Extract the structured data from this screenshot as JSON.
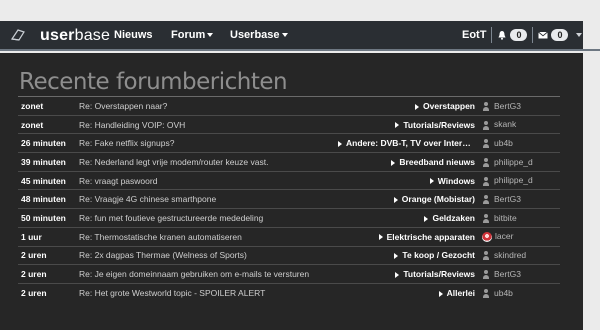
{
  "navbar": {
    "brand_prefix": "user",
    "brand_suffix": "base",
    "menu": [
      {
        "label": "Nieuws",
        "dropdown": false
      },
      {
        "label": "Forum",
        "dropdown": true
      },
      {
        "label": "Userbase",
        "dropdown": true
      }
    ],
    "username": "EotT",
    "notifications_count": "0",
    "messages_count": "0",
    "icons": [
      "logo-icon",
      "bell-icon",
      "envelope-icon",
      "chevron-down-icon"
    ]
  },
  "page": {
    "title": "Recente forumberichten"
  },
  "topics": [
    {
      "time": "zonet",
      "title": "Re: Overstappen naar?",
      "forum": "Overstappen",
      "user": "BertG3",
      "avatar": "user-icon"
    },
    {
      "time": "zonet",
      "title": "Re: Handleiding VOIP: OVH",
      "forum": "Tutorials/Reviews",
      "user": "skank",
      "avatar": "user-icon"
    },
    {
      "time": "26 minuten",
      "title": "Re: Fake netflix signups?",
      "forum": "Andere: DVB-T, TV over Interne...",
      "user": "ub4b",
      "avatar": "user-icon"
    },
    {
      "time": "39 minuten",
      "title": "Re: Nederland legt vrije modem/router keuze vast.",
      "forum": "Breedband nieuws",
      "user": "philippe_d",
      "avatar": "user-icon"
    },
    {
      "time": "45 minuten",
      "title": "Re: vraagt paswoord",
      "forum": "Windows",
      "user": "philippe_d",
      "avatar": "user-icon"
    },
    {
      "time": "48 minuten",
      "title": "Re: Vraagje 4G chinese smarthpone",
      "forum": "Orange (Mobistar)",
      "user": "BertG3",
      "avatar": "user-icon"
    },
    {
      "time": "50 minuten",
      "title": "Re: fun met foutieve gestructureerde mededeling",
      "forum": "Geldzaken",
      "user": "bitbite",
      "avatar": "user-icon"
    },
    {
      "time": "1 uur",
      "title": "Re: Thermostatische kranen automatiseren",
      "forum": "Elektrische apparaten",
      "user": "lacer",
      "avatar": "avatar-image"
    },
    {
      "time": "2 uren",
      "title": "Re: 2x dagpas Thermae (Welness of Sports)",
      "forum": "Te koop / Gezocht",
      "user": "skindred",
      "avatar": "user-icon"
    },
    {
      "time": "2 uren",
      "title": "Re: Je eigen domeinnaam gebruiken om e-mails te versturen",
      "forum": "Tutorials/Reviews",
      "user": "BertG3",
      "avatar": "user-icon"
    },
    {
      "time": "2 uren",
      "title": "Re: Het grote Westworld topic - SPOILER ALERT",
      "forum": "Allerlei",
      "user": "ub4b",
      "avatar": "user-icon"
    }
  ],
  "colors": {
    "navbar_bg": "#2a2e33",
    "content_bg": "#262626",
    "title_text": "#8e8e8e"
  }
}
